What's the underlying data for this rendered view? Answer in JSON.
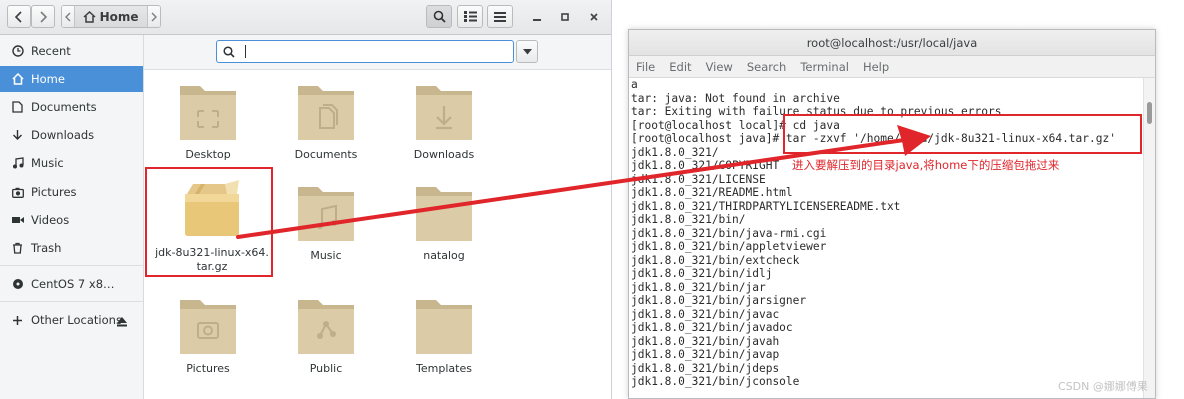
{
  "file_manager": {
    "header": {
      "location": "Home"
    },
    "sidebar": {
      "items": [
        {
          "label": "Recent",
          "icon": "clock-icon"
        },
        {
          "label": "Home",
          "icon": "home-icon",
          "active": true
        },
        {
          "label": "Documents",
          "icon": "document-icon"
        },
        {
          "label": "Downloads",
          "icon": "download-icon"
        },
        {
          "label": "Music",
          "icon": "music-icon"
        },
        {
          "label": "Pictures",
          "icon": "camera-icon"
        },
        {
          "label": "Videos",
          "icon": "video-icon"
        },
        {
          "label": "Trash",
          "icon": "trash-icon"
        },
        {
          "label": "CentOS 7 x8…",
          "icon": "disc-icon"
        },
        {
          "label": "Other Locations",
          "icon": "plus-icon"
        }
      ]
    },
    "search": {
      "value": ""
    },
    "files": [
      {
        "name": "Desktop",
        "type": "folder"
      },
      {
        "name": "Documents",
        "type": "folder"
      },
      {
        "name": "Downloads",
        "type": "folder"
      },
      {
        "name": "jdk-8u321-linux-x64.\ntar.gz",
        "type": "archive"
      },
      {
        "name": "Music",
        "type": "folder"
      },
      {
        "name": "natalog",
        "type": "folder"
      },
      {
        "name": "Pictures",
        "type": "folder"
      },
      {
        "name": "Public",
        "type": "folder"
      },
      {
        "name": "Templates",
        "type": "folder"
      }
    ]
  },
  "terminal": {
    "title": "root@localhost:/usr/local/java",
    "menu": [
      "File",
      "Edit",
      "View",
      "Search",
      "Terminal",
      "Help"
    ],
    "lines": [
      "a",
      "tar: java: Not found in archive",
      "tar: Exiting with failure status due to previous errors",
      "[root@localhost local]# cd java",
      "[root@localhost java]# tar -zxvf '/home/nata/jdk-8u321-linux-x64.tar.gz'",
      "jdk1.8.0_321/",
      "jdk1.8.0_321/COPYRIGHT",
      "jdk1.8.0_321/LICENSE",
      "jdk1.8.0_321/README.html",
      "jdk1.8.0_321/THIRDPARTYLICENSEREADME.txt",
      "jdk1.8.0_321/bin/",
      "jdk1.8.0_321/bin/java-rmi.cgi",
      "jdk1.8.0_321/bin/appletviewer",
      "jdk1.8.0_321/bin/extcheck",
      "jdk1.8.0_321/bin/idlj",
      "jdk1.8.0_321/bin/jar",
      "jdk1.8.0_321/bin/jarsigner",
      "jdk1.8.0_321/bin/javac",
      "jdk1.8.0_321/bin/javadoc",
      "jdk1.8.0_321/bin/javah",
      "jdk1.8.0_321/bin/javap",
      "jdk1.8.0_321/bin/jdeps",
      "jdk1.8.0_321/bin/jconsole"
    ]
  },
  "annotation": "进入要解压到的目录java,将home下的压缩包拖过来",
  "watermark": "CSDN @娜娜傅果",
  "colors": {
    "accent": "#4a90d9",
    "highlight": "#e0262b",
    "folder": "#d9c8a5"
  }
}
